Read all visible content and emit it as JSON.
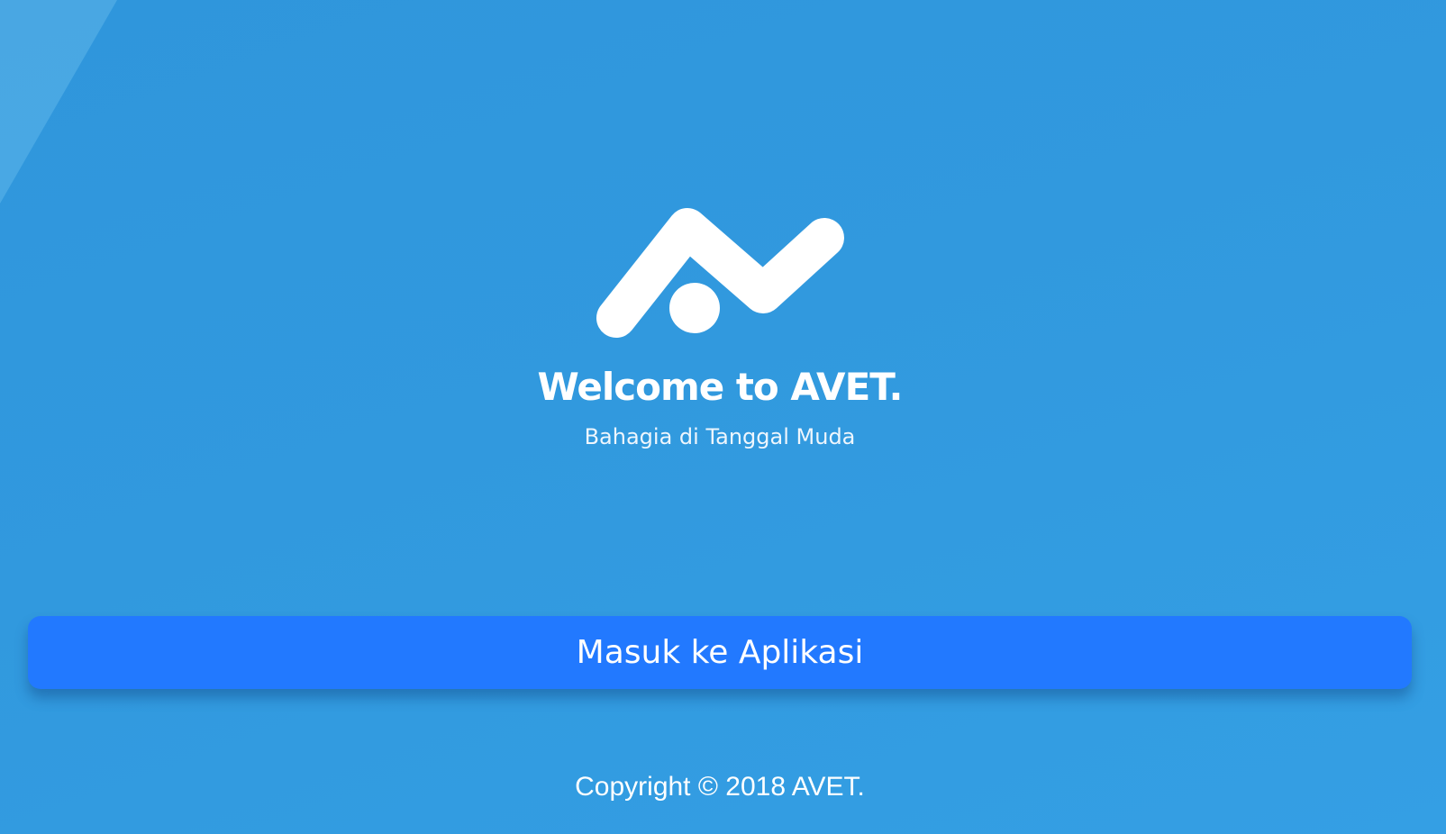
{
  "colors": {
    "background": "#3199de",
    "button": "#2279ff",
    "text": "#ffffff"
  },
  "logo": {
    "icon": "avet-logo-icon"
  },
  "welcome": {
    "title": "Welcome to AVET.",
    "subtitle": "Bahagia di Tanggal Muda"
  },
  "actions": {
    "enter_label": "Masuk ke Aplikasi"
  },
  "footer": {
    "copyright": "Copyright © 2018 AVET."
  }
}
